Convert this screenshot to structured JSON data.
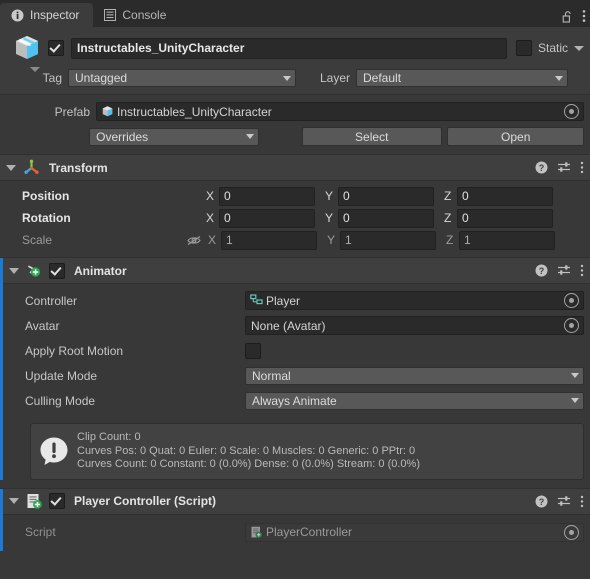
{
  "window": {
    "tabs": [
      {
        "label": "Inspector",
        "icon": "info-icon",
        "active": true
      },
      {
        "label": "Console",
        "icon": "console-list-icon",
        "active": false
      }
    ],
    "lock_icon": "lock-open-icon",
    "menu_icon": "kebab-menu-icon"
  },
  "gameobject": {
    "icon": "prefab-cube-icon",
    "enabled": true,
    "name": "Instructables_UnityCharacter",
    "static_label": "Static",
    "static_checked": false,
    "tag_label": "Tag",
    "tag_value": "Untagged",
    "layer_label": "Layer",
    "layer_value": "Default"
  },
  "prefab": {
    "label": "Prefab",
    "asset_name": "Instructables_UnityCharacter",
    "asset_icon": "prefab-cube-icon",
    "overrides_label": "Overrides",
    "select_label": "Select",
    "open_label": "Open"
  },
  "components": [
    {
      "name": "Transform",
      "icon": "transform-gizmo-icon",
      "has_toggle": false,
      "override_bar": false,
      "rows": [
        {
          "label": "Position",
          "dim": false,
          "values": [
            "0",
            "0",
            "0"
          ]
        },
        {
          "label": "Rotation",
          "dim": false,
          "values": [
            "0",
            "0",
            "0"
          ]
        },
        {
          "label": "Scale",
          "dim": true,
          "values": [
            "1",
            "1",
            "1"
          ],
          "lock_icon": "constrained-proportions-off-icon"
        }
      ],
      "axes": [
        "X",
        "Y",
        "Z"
      ]
    },
    {
      "name": "Animator",
      "icon": "animator-icon",
      "has_toggle": true,
      "enabled": true,
      "override_bar": true,
      "fields": [
        {
          "label": "Controller",
          "type": "object",
          "value": "Player",
          "icon": "animator-controller-icon"
        },
        {
          "label": "Avatar",
          "type": "object",
          "value": "None (Avatar)",
          "icon": "none-icon"
        },
        {
          "label": "Apply Root Motion",
          "type": "checkbox",
          "checked": false
        },
        {
          "label": "Update Mode",
          "type": "dropdown",
          "value": "Normal"
        },
        {
          "label": "Culling Mode",
          "type": "dropdown",
          "value": "Always Animate"
        }
      ],
      "helpbox": {
        "icon": "warning-icon",
        "lines": [
          "Clip Count: 0",
          "Curves Pos: 0 Quat: 0 Euler: 0 Scale: 0 Muscles: 0 Generic: 0 PPtr: 0",
          "Curves Count: 0 Constant: 0 (0.0%) Dense: 0 (0.0%) Stream: 0 (0.0%)"
        ]
      }
    },
    {
      "name": "Player Controller (Script)",
      "icon": "csharp-script-icon",
      "has_toggle": true,
      "enabled": true,
      "override_bar": true,
      "fields": [
        {
          "label": "Script",
          "type": "object",
          "value": "PlayerController",
          "icon": "csharp-script-icon",
          "disabled": true
        }
      ]
    }
  ],
  "header_icons": {
    "help": "help-icon",
    "preset": "preset-settings-icon",
    "menu": "kebab-menu-icon"
  },
  "colors": {
    "background": "#383838",
    "header": "#3c3c3c",
    "tabbar": "#2b2b2b",
    "field": "#2a2a2a",
    "button": "#585858",
    "override_blue": "#1c7ad4",
    "text": "#c4c4c4"
  }
}
